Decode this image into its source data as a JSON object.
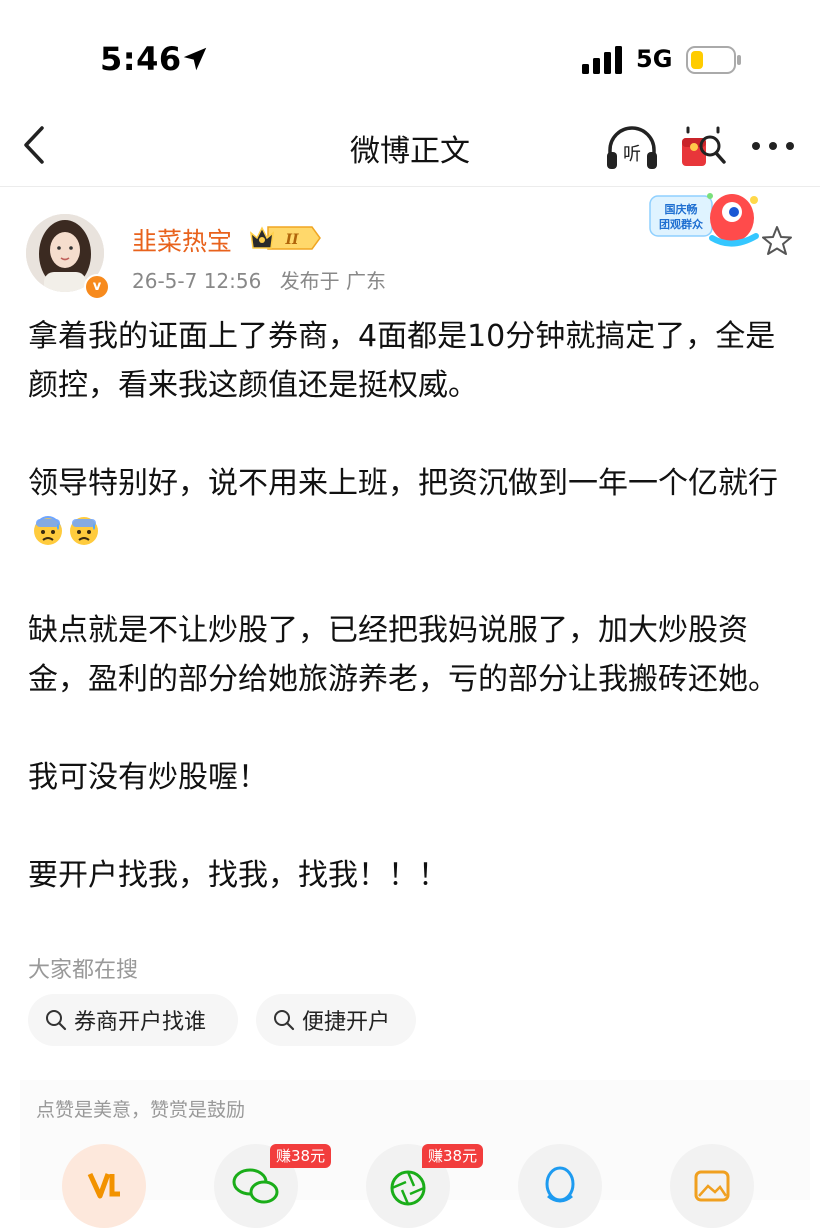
{
  "status_bar": {
    "time": "5:46",
    "network": "5G",
    "battery_level": 0.3,
    "battery_color": "#ffcc00"
  },
  "nav": {
    "title": "微博正文",
    "back_icon": "chevron-left-icon",
    "listen_icon": "headphones-icon",
    "listen_label": "听",
    "redpack_icon": "red-envelope-icon",
    "more_icon": "ellipsis-icon"
  },
  "post": {
    "author": "韭菜热宝",
    "author_color": "#e8621c",
    "vip_level": "II",
    "verified_icon": "verified-v-icon",
    "timestamp": "26-5-7 12:56",
    "location": "发布于 广东",
    "paragraphs": [
      "拿着我的证面上了券商，4面都是10分钟就搞定了，全是颜控，看来我这颜值还是挺权威。",
      "领导特别好，说不用来上班，把资沉做到一年一个亿就行",
      "缺点就是不让炒股了，已经把我妈说服了，加大炒股资金，盈利的部分给她旅游养老，亏的部分让我搬砖还她。",
      "我可没有炒股喔！",
      "要开户找我，找我，找我！！！"
    ],
    "emojis": [
      "anxious-sweat-emoji",
      "anxious-sweat-emoji"
    ],
    "event_badge_text": "国庆畅 团观群众",
    "favorite_icon": "star-outline-icon"
  },
  "hot_search": {
    "title": "大家都在搜",
    "chips": [
      {
        "label": "券商开户找谁",
        "icon": "search-icon"
      },
      {
        "label": "便捷开户",
        "icon": "search-icon"
      }
    ]
  },
  "tip": {
    "text": "点赞是美意，赞赏是鼓励",
    "tags": [
      "赚38元",
      "赚38元"
    ],
    "buttons": [
      "vip-like-icon",
      "wechat-icon",
      "camera-aperture-icon",
      "qq-icon",
      "image-icon"
    ]
  }
}
